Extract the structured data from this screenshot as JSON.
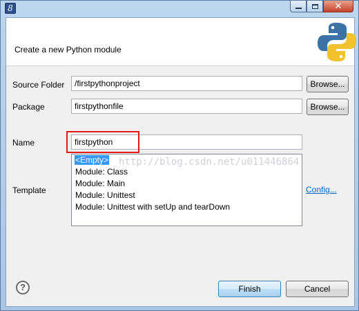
{
  "window": {
    "icon": "eclipse-icon",
    "buttons": {
      "minimize": "minimize-icon",
      "maximize": "maximize-icon",
      "close": "close-icon",
      "close_glyph": "✕"
    }
  },
  "banner": {
    "message": "Create a new Python module",
    "logo": "python-logo"
  },
  "source_folder": {
    "label": "Source Folder",
    "value": "/firstpythonproject",
    "browse": "Browse..."
  },
  "package": {
    "label": "Package",
    "value": "firstpythonfile",
    "browse": "Browse..."
  },
  "name": {
    "label": "Name",
    "value": "firstpython"
  },
  "template": {
    "label": "Template",
    "options": [
      "<Empty>",
      "Module: Class",
      "Module: Main",
      "Module: Unittest",
      "Module: Unittest with setUp and tearDown"
    ],
    "selected_index": 0,
    "config_link": "Config...",
    "watermark": "http://blog.csdn.net/u011446864"
  },
  "footer": {
    "help_glyph": "?",
    "finish": "Finish",
    "cancel": "Cancel"
  },
  "colors": {
    "highlight_box": "#e01818",
    "selection": "#3399ff",
    "link": "#0066cc"
  }
}
